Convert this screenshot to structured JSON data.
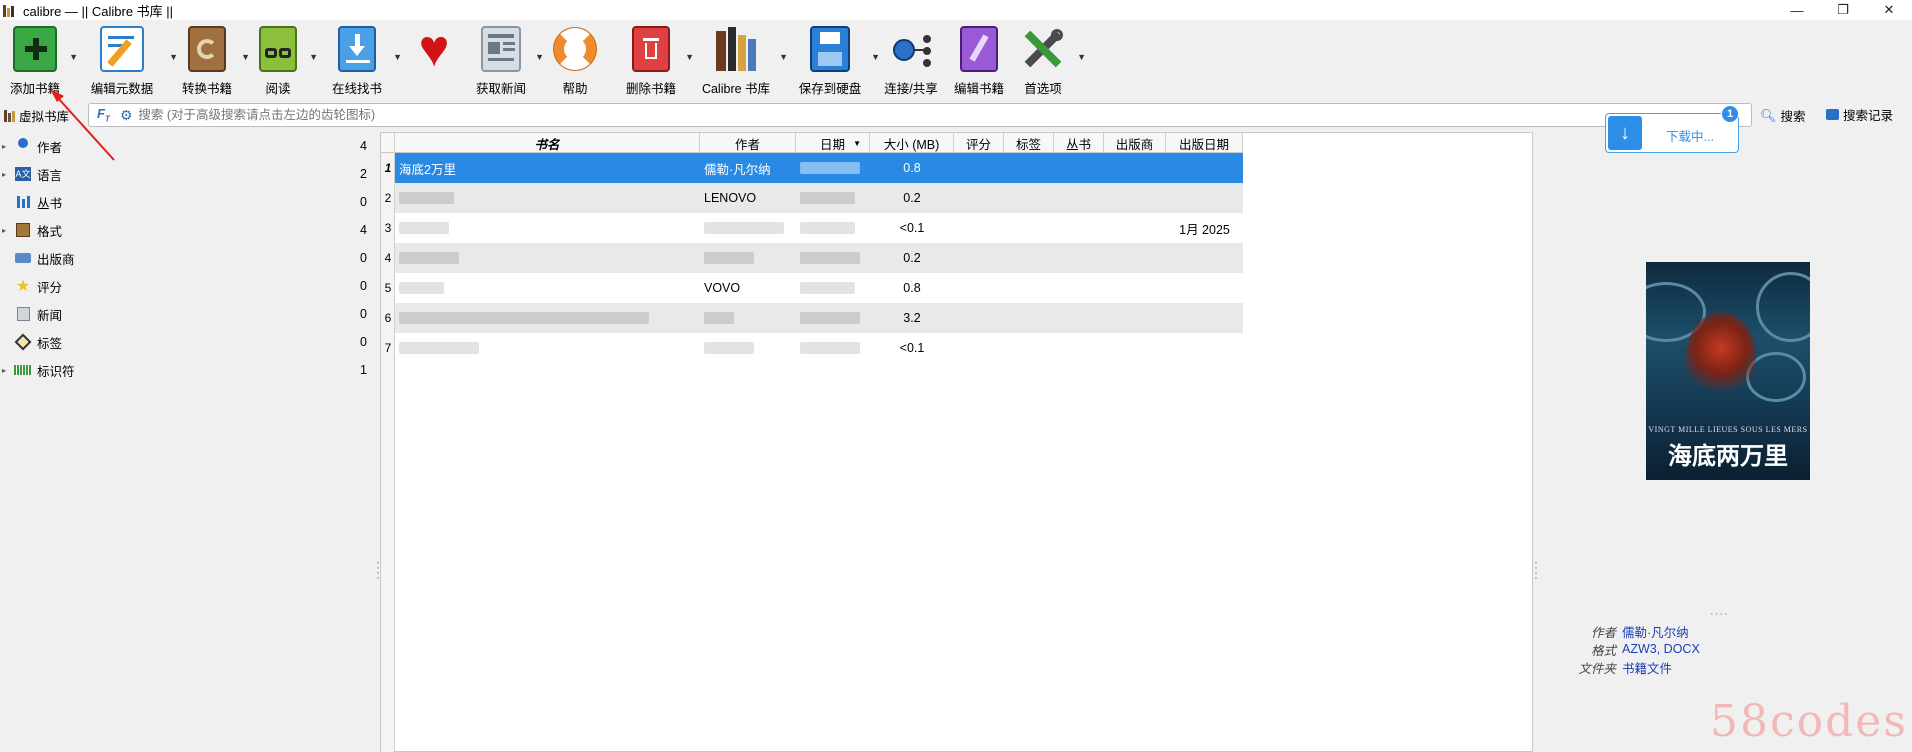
{
  "window": {
    "title": "calibre — || Calibre 书库 ||",
    "minimize": "—",
    "maximize": "❐",
    "close": "✕"
  },
  "toolbar": {
    "items": [
      {
        "label": "添加书籍",
        "icon": "add-book-icon"
      },
      {
        "label": "编辑元数据",
        "icon": "edit-metadata-icon"
      },
      {
        "label": "转换书籍",
        "icon": "convert-icon"
      },
      {
        "label": "阅读",
        "icon": "read-icon"
      },
      {
        "label": "在线找书",
        "icon": "download-icon"
      },
      {
        "label": "",
        "icon": "heart-icon"
      },
      {
        "label": "获取新闻",
        "icon": "news-icon"
      },
      {
        "label": "帮助",
        "icon": "help-icon"
      },
      {
        "label": "删除书籍",
        "icon": "trash-icon"
      },
      {
        "label": "Calibre 书库",
        "icon": "library-icon"
      },
      {
        "label": "保存到硬盘",
        "icon": "save-icon"
      },
      {
        "label": "连接/共享",
        "icon": "connect-icon"
      },
      {
        "label": "编辑书籍",
        "icon": "edit-book-icon"
      },
      {
        "label": "首选项",
        "icon": "preferences-icon"
      }
    ]
  },
  "search": {
    "virtual_library": "虚拟书库",
    "placeholder": "搜索 (对于高级搜索请点击左边的齿轮图标)",
    "search_label": "搜索",
    "history_label": "搜索记录"
  },
  "download": {
    "text": "下载中...",
    "count": "1"
  },
  "tag_browser": [
    {
      "label": "作者",
      "count": "4",
      "icon": "person-icon",
      "expandable": true
    },
    {
      "label": "语言",
      "count": "2",
      "icon": "language-icon",
      "expandable": true
    },
    {
      "label": "丛书",
      "count": "0",
      "icon": "series-icon",
      "expandable": false
    },
    {
      "label": "格式",
      "count": "4",
      "icon": "format-icon",
      "expandable": true
    },
    {
      "label": "出版商",
      "count": "0",
      "icon": "publisher-icon",
      "expandable": false
    },
    {
      "label": "评分",
      "count": "0",
      "icon": "star-icon",
      "expandable": false
    },
    {
      "label": "新闻",
      "count": "0",
      "icon": "news-icon",
      "expandable": false
    },
    {
      "label": "标签",
      "count": "0",
      "icon": "tag-icon",
      "expandable": false
    },
    {
      "label": "标识符",
      "count": "1",
      "icon": "barcode-icon",
      "expandable": true
    }
  ],
  "table": {
    "columns": [
      "书名",
      "作者",
      "日期",
      "大小 (MB)",
      "评分",
      "标签",
      "丛书",
      "出版商",
      "出版日期"
    ],
    "rows": [
      {
        "num": "1",
        "title": "海底2万里",
        "author": "儒勒·凡尔纳",
        "date": "",
        "size": "0.8",
        "pubdate": "",
        "selected": true
      },
      {
        "num": "2",
        "title": "",
        "author": "LENOVO",
        "date": "",
        "size": "0.2",
        "pubdate": ""
      },
      {
        "num": "3",
        "title": "",
        "author": "",
        "date": "",
        "size": "<0.1",
        "pubdate": "1月 2025"
      },
      {
        "num": "4",
        "title": "",
        "author": "",
        "date": "",
        "size": "0.2",
        "pubdate": ""
      },
      {
        "num": "5",
        "title": "",
        "author": "VOVO",
        "date": "",
        "size": "0.8",
        "pubdate": ""
      },
      {
        "num": "6",
        "title": "",
        "author": "",
        "date": "",
        "size": "3.2",
        "pubdate": ""
      },
      {
        "num": "7",
        "title": "",
        "author": "",
        "date": "",
        "size": "<0.1",
        "pubdate": ""
      }
    ]
  },
  "cover": {
    "subtitle": "VINGT MILLE LIEUES SOUS LES MERS",
    "title": "海底两万里"
  },
  "details": [
    {
      "key": "作者",
      "value": "儒勒·凡尔纳"
    },
    {
      "key": "格式",
      "value": "AZW3, DOCX"
    },
    {
      "key": "文件夹",
      "value": "书籍文件"
    }
  ],
  "watermark": "58codes",
  "colors": {
    "selection": "#2a8ae3",
    "link": "#1a3fb8",
    "annotation": "#e02020"
  }
}
